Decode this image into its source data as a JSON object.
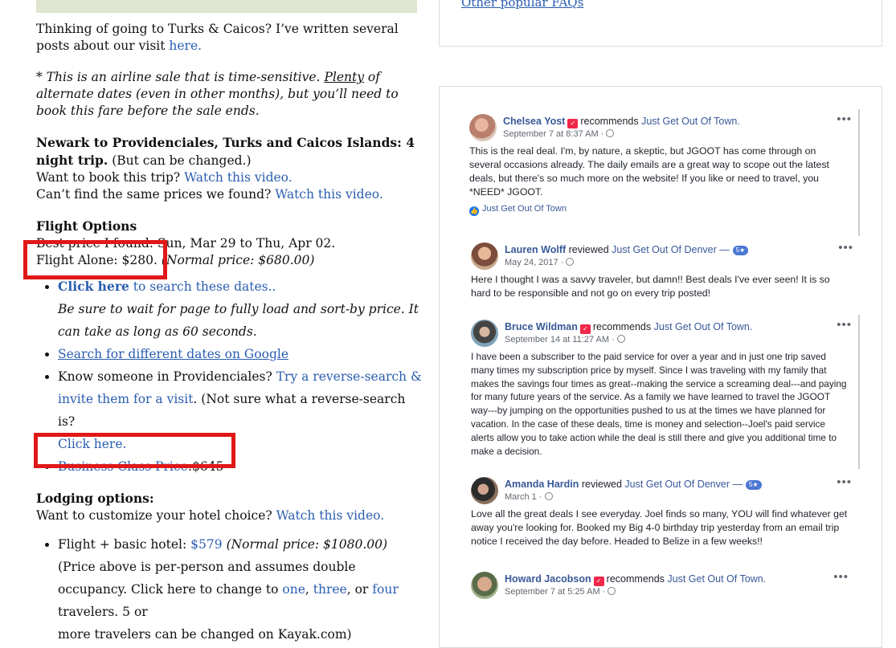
{
  "article": {
    "intro_text": "Thinking of going to Turks & Caicos? I’ve written several posts about our visit",
    "intro_link": "here.",
    "sale_note_1": "* This is an airline sale that is time-sensitive.",
    "sale_note_plenty": "Plenty",
    "sale_note_2": "of alternate dates (even in other months), but you’ll need to book this fare before the sale ends.",
    "route_title": "Newark to Providenciales, Turks and Caicos Islands: 4 night trip.",
    "route_note": "(But can be changed.)",
    "book_text": "Want to book this trip?",
    "book_link": "Watch this video.",
    "prices_text": "Can’t find the same prices we found?",
    "prices_link": "Watch this video.",
    "flight_heading": "Flight Options",
    "best_price": "Best price I found: Sun, Mar 29 to Thu, Apr 02.",
    "flight_alone": "Flight Alone: $280.",
    "flight_alone_normal": "(Normal price: $680.00)",
    "click_here_bold": "Click here",
    "click_here_rest": "to search these dates..",
    "wait_note": "Be sure to wait for page to fully load and sort-by price. It can take as long as 60 seconds.",
    "google_link": "Search for different dates on Google",
    "know_text": "Know someone in Providenciales?",
    "reverse_link": "Try a reverse-search & invite them for a visit",
    "not_sure": ". (Not sure what a reverse-search is?",
    "click_here_2": "Click here.",
    "business_link": "Business Class Price",
    "business_price": ":$645",
    "lodging_heading": "Lodging options:",
    "customize_text": "Want to customize your hotel choice?",
    "customize_link": "Watch this video.",
    "hotel_label": "Flight + basic hotel:",
    "hotel_price": "$579",
    "hotel_normal": "(Normal price: $1080.00)",
    "hotel_note": "(Price above is per-person and assumes double occupancy. Click here to change to",
    "opt_one": "one",
    "opt_three": "three",
    "or_text": ", or",
    "opt_four": "four",
    "travelers_text": "travelers. 5 or",
    "more_text": "more travelers can be changed on Kayak.com)"
  },
  "sidebar": {
    "faq_link": "Other popular FAQs",
    "recommends": "recommends",
    "reviewed": "reviewed",
    "reviews": [
      {
        "name": "Chelsea Yost",
        "action": "recommends",
        "page": "Just Get Out Of Town.",
        "date": "September 7 at 8:37 AM ·",
        "text": "This is the real deal. I'm, by nature, a skeptic, but JGOOT has come through on several occasions already. The daily emails are a great way to scope out the latest deals, but there's so much more on the website! If you like or need to travel, you *NEED* JGOOT.",
        "footer": "Just Get Out Of Town"
      },
      {
        "name": "Lauren Wolff",
        "action": "reviewed",
        "page": "Just Get Out Of Denver —",
        "badge": "5★",
        "date": "May 24, 2017 ·",
        "text": "Here I thought I was a savvy traveler, but damn!! Best deals I've ever seen! It is so hard to be responsible and not go on every trip posted!"
      },
      {
        "name": "Bruce Wildman",
        "action": "recommends",
        "page": "Just Get Out Of Town.",
        "date": "September 14 at 11:27 AM ·",
        "text": "I have been a subscriber to the paid service for over a year and in just one trip saved many times my subscription price by myself. Since I was traveling with my family that makes the savings four times as great--making the service a screaming deal---and paying for many future years of the service. As a family we have learned to travel the JGOOT way---by jumping on the opportunities pushed to us at the times we have planned for vacation. In the case of these deals, time is money and selection--Joel's paid service alerts allow you to take action while the deal is still there and give you additional time to make a decision."
      },
      {
        "name": "Amanda Hardin",
        "action": "reviewed",
        "page": "Just Get Out Of Denver —",
        "badge": "5★",
        "date": "March 1 ·",
        "text": "Love all the great deals I see everyday. Joel finds so many, YOU will find whatever get away you're looking for. Booked my Big 4-0 birthday trip yesterday from an email trip notice I received the day before. Headed to Belize in a few weeks!!"
      },
      {
        "name": "Howard Jacobson",
        "action": "recommends",
        "page": "Just Get Out Of Town.",
        "date": "September 7 at 5:25 AM ·",
        "text": ""
      }
    ]
  },
  "colors": {
    "link": "#2a5db0",
    "highlight_box": "#e01818",
    "fb_blue": "#385898"
  },
  "icons": [
    "recommend-icon",
    "globe-icon",
    "more-options-icon",
    "like-icon"
  ]
}
